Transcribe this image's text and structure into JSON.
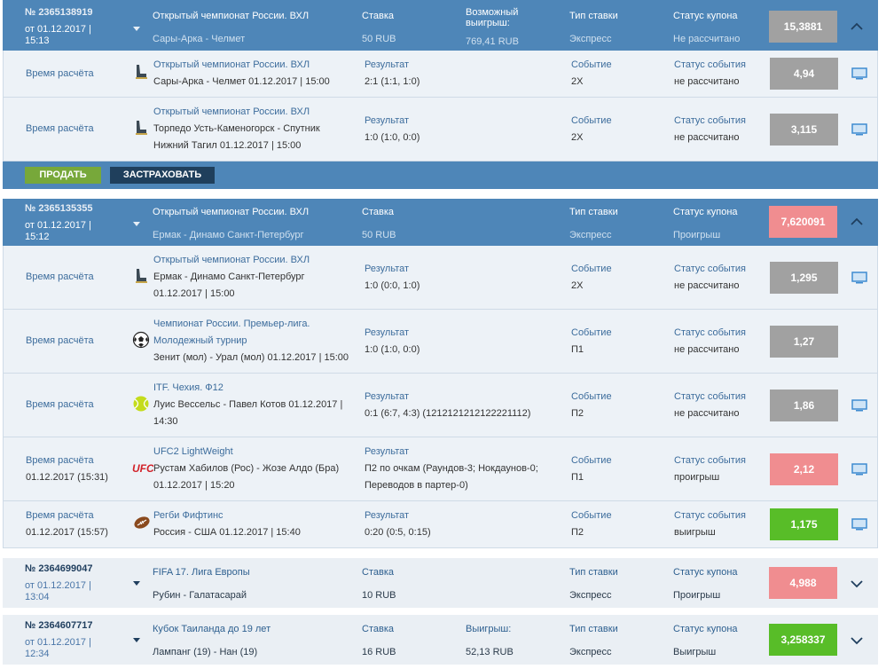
{
  "labels": {
    "bet": "Ставка",
    "possible_win": "Возможный выигрыш:",
    "win": "Выигрыш:",
    "bet_type": "Тип ставки",
    "coupon_status": "Статус купона",
    "calc_time": "Время расчёта",
    "result": "Результат",
    "event": "Событие",
    "event_status": "Статус события",
    "sell": "ПРОДАТЬ",
    "insure": "ЗАСТРАХОВАТЬ"
  },
  "coupons": [
    {
      "id": "№ 2365138919",
      "date": "от 01.12.2017 | 15:13",
      "league": "Открытый чемпионат России. ВХЛ",
      "match": "Сары-Арка - Челмет",
      "stake": "50 RUB",
      "possible_win": "769,41 RUB",
      "bet_type": "Экспресс",
      "status": "Не рассчитано",
      "odds": "15,3881",
      "events": [
        {
          "calc_time": "Время расчёта",
          "icon": "hockey-icon",
          "league": "Открытый чемпионат России. ВХЛ",
          "lines": [
            "Сары-Арка - Челмет 01.12.2017 | 15:00"
          ],
          "result_lines": [
            "2:1 (1:1, 1:0)"
          ],
          "event": "2Х",
          "status": "не рассчитано",
          "odds": "4,94"
        },
        {
          "calc_time": "Время расчёта",
          "icon": "hockey-icon",
          "league": "Открытый чемпионат России. ВХЛ",
          "lines": [
            "Торпедо Усть-Каменогорск - Спутник",
            "Нижний Тагил 01.12.2017 | 15:00"
          ],
          "result_lines": [
            "1:0 (1:0, 0:0)"
          ],
          "event": "2Х",
          "status": "не рассчитано",
          "odds": "3,115"
        }
      ]
    },
    {
      "id": "№ 2365135355",
      "date": "от 01.12.2017 | 15:12",
      "league": "Открытый чемпионат России. ВХЛ",
      "match": "Ермак - Динамо Санкт-Петербург",
      "stake": "50 RUB",
      "bet_type": "Экспресс",
      "status": "Проигрыш",
      "odds": "7,620091",
      "events": [
        {
          "calc_time": "Время расчёта",
          "icon": "hockey-icon",
          "league": "Открытый чемпионат России. ВХЛ",
          "lines": [
            "Ермак - Динамо Санкт-Петербург",
            "01.12.2017 | 15:00"
          ],
          "result_lines": [
            "1:0 (0:0, 1:0)"
          ],
          "event": "2Х",
          "status": "не рассчитано",
          "odds": "1,295"
        },
        {
          "calc_time": "Время расчёта",
          "icon": "football-icon",
          "league": "Чемпионат России. Премьер-лига.",
          "league2": "Молодежный турнир",
          "lines": [
            "Зенит (мол) - Урал (мол) 01.12.2017 | 15:00"
          ],
          "result_lines": [
            "1:0 (1:0, 0:0)"
          ],
          "event": "П1",
          "status": "не рассчитано",
          "odds": "1,27"
        },
        {
          "calc_time": "Время расчёта",
          "icon": "tennis-icon",
          "league": "ITF. Чехия. Ф12",
          "lines": [
            "Луис Вессельс - Павел Котов 01.12.2017 |",
            "14:30"
          ],
          "result_lines": [
            "0:1 (6:7, 4:3) (1212121212122221112)"
          ],
          "event": "П2",
          "status": "не рассчитано",
          "odds": "1,86"
        },
        {
          "calc_time": "Время расчёта",
          "calc_date": "01.12.2017 (15:31)",
          "icon": "ufc-icon",
          "league": "UFC2 LightWeight",
          "lines": [
            "Рустам Хабилов (Рос) - Жозе Алдо (Бра)",
            "01.12.2017 | 15:20"
          ],
          "result_lines": [
            "П2 по очкам (Раундов-3; Нокдаунов-0;",
            "Переводов в партер-0)"
          ],
          "event": "П1",
          "status": "проигрыш",
          "odds": "2,12"
        },
        {
          "calc_time": "Время расчёта",
          "calc_date": "01.12.2017 (15:57)",
          "icon": "rugby-icon",
          "league": "Регби Фифтинс",
          "lines": [
            "Россия - США 01.12.2017 | 15:40"
          ],
          "result_lines": [
            "0:20 (0:5, 0:15)"
          ],
          "event": "П2",
          "status": "выигрыш",
          "odds": "1,175"
        }
      ]
    },
    {
      "id": "№ 2364699047",
      "date": "от 01.12.2017 | 13:04",
      "league": "FIFA 17. Лига Европы",
      "match": "Рубин - Галатасарай",
      "stake": "10 RUB",
      "bet_type": "Экспресс",
      "status": "Проигрыш",
      "odds": "4,988"
    },
    {
      "id": "№ 2364607717",
      "date": "от 01.12.2017 | 12:34",
      "league": "Кубок Таиланда до 19 лет",
      "match": "Лампанг (19) - Нан (19)",
      "stake": "16 RUB",
      "win": "52,13 RUB",
      "bet_type": "Экспресс",
      "status": "Выигрыш",
      "odds": "3,258337"
    }
  ]
}
